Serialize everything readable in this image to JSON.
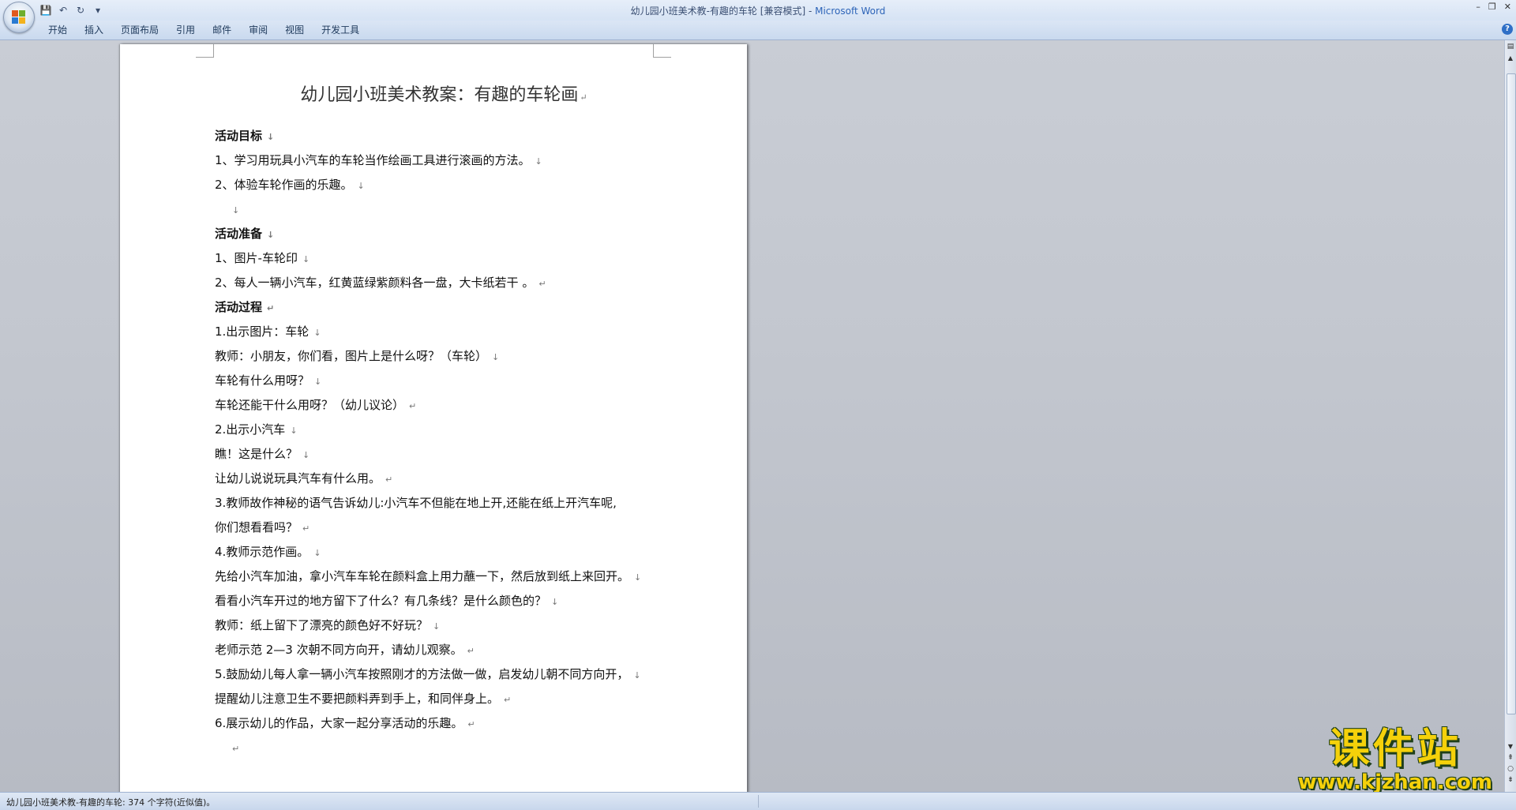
{
  "window": {
    "title_doc": "幼儿园小班美术教-有趣的车轮 [兼容模式] - ",
    "title_app": "Microsoft Word",
    "controls": [
      "–",
      "❐",
      "✕"
    ]
  },
  "ribbon": {
    "tabs": [
      "开始",
      "插入",
      "页面布局",
      "引用",
      "邮件",
      "审阅",
      "视图",
      "开发工具"
    ]
  },
  "document": {
    "title": "幼儿园小班美术教案：有趣的车轮画",
    "paragraphs": [
      {
        "text": "活动目标",
        "bold": true,
        "mark": "↓"
      },
      {
        "text": "1、学习用玩具小汽车的车轮当作绘画工具进行滚画的方法。",
        "mark": "↓"
      },
      {
        "text": "2、体验车轮作画的乐趣。",
        "mark": "↓"
      },
      {
        "text": "",
        "mark": "↓"
      },
      {
        "text": "活动准备",
        "bold": true,
        "mark": "↓"
      },
      {
        "text": "1、图片-车轮印",
        "mark": "↓"
      },
      {
        "text": "2、每人一辆小汽车，红黄蓝绿紫颜料各一盘，大卡纸若干 。",
        "mark": "↵"
      },
      {
        "text": "活动过程",
        "bold": true,
        "mark": "↵"
      },
      {
        "text": "1.出示图片：车轮",
        "mark": "↓"
      },
      {
        "text": "教师：小朋友，你们看，图片上是什么呀？（车轮）",
        "mark": "↓"
      },
      {
        "text": "车轮有什么用呀？",
        "mark": "↓"
      },
      {
        "text": "车轮还能干什么用呀？（幼儿议论）",
        "mark": "↵"
      },
      {
        "text": "2.出示小汽车",
        "mark": "↓"
      },
      {
        "text": "瞧！这是什么？",
        "mark": "↓"
      },
      {
        "text": "让幼儿说说玩具汽车有什么用。",
        "mark": "↵"
      },
      {
        "text": "3.教师故作神秘的语气告诉幼儿:小汽车不但能在地上开,还能在纸上开汽车呢,",
        "mark": ""
      },
      {
        "text": "你们想看看吗？",
        "mark": "↵"
      },
      {
        "text": "4.教师示范作画。",
        "mark": "↓"
      },
      {
        "text": "先给小汽车加油，拿小汽车车轮在颜料盒上用力蘸一下，然后放到纸上来回开。",
        "mark": "↓"
      },
      {
        "text": "看看小汽车开过的地方留下了什么？有几条线？是什么颜色的？",
        "mark": "↓"
      },
      {
        "text": "教师：纸上留下了漂亮的颜色好不好玩？",
        "mark": "↓"
      },
      {
        "text": "老师示范 2—3 次朝不同方向开，请幼儿观察。",
        "mark": "↵"
      },
      {
        "text": "5.鼓励幼儿每人拿一辆小汽车按照刚才的方法做一做，启发幼儿朝不同方向开，",
        "mark": "↓"
      },
      {
        "text": "提醒幼儿注意卫生不要把颜料弄到手上，和同伴身上。",
        "mark": "↵"
      },
      {
        "text": "6.展示幼儿的作品，大家一起分享活动的乐趣。",
        "mark": "↵"
      },
      {
        "text": "",
        "mark": "↵"
      }
    ]
  },
  "status": {
    "text": "幼儿园小班美术教-有趣的车轮: 374 个字符(近似值)。"
  },
  "watermark": {
    "main": "课件站",
    "url": "www.kjzhan.com"
  },
  "icons": {
    "save": "💾",
    "undo": "↶",
    "redo": "↻",
    "customize": "▾",
    "help": "?"
  }
}
